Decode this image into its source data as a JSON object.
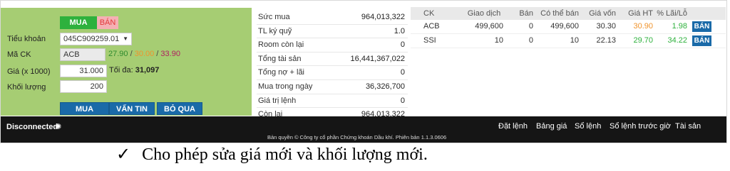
{
  "order_panel": {
    "tab_buy": "MUA",
    "tab_sell": "BÁN",
    "account_label": "Tiểu khoản",
    "account_value": "045C909259.01",
    "symbol_label": "Mã CK",
    "symbol_value": "ACB",
    "price_ref": "27.90",
    "price_sep1": " / ",
    "price_floor": "30.00",
    "price_sep2": " / ",
    "price_ceiling": "33.90",
    "price_label": "Giá (x 1000)",
    "price_value": "31.000",
    "max_label": "Tối đa:",
    "max_value": "31,097",
    "qty_label": "Khối lượng",
    "qty_value": "200",
    "btn_buy": "MUA",
    "btn_query": "VẤN TIN",
    "btn_skip": "BỎ QUA",
    "colors": {
      "ref": "#2e8b2e",
      "floor": "#f0932b",
      "ceiling": "#b02060",
      "panel": "#a6cd73"
    }
  },
  "summary": [
    {
      "label": "Sức mua",
      "value": "964,013,322"
    },
    {
      "label": "TL ký quỹ",
      "value": "1.0"
    },
    {
      "label": "Room còn lại",
      "value": "0"
    },
    {
      "label": "Tổng tài sản",
      "value": "16,441,367,022"
    },
    {
      "label": "Tổng nợ + lãi",
      "value": "0"
    },
    {
      "label": "Mua trong ngày",
      "value": "36,326,700"
    },
    {
      "label": "Giá trị lệnh",
      "value": "0"
    },
    {
      "label": "Còn lại",
      "value": "964,013,322"
    }
  ],
  "portfolio": {
    "headers": {
      "ck": "CK",
      "trade": "Giao dịch",
      "sell": "Bán",
      "can_sell": "Có thể bán",
      "cost": "Giá vốn",
      "price": "Giá HT",
      "pl": "% Lãi/Lỗ"
    },
    "rows": [
      {
        "ck": "ACB",
        "trade": "499,600",
        "sell": "0",
        "can_sell": "499,600",
        "cost": "30.30",
        "price": "30.90",
        "pl": "1.98",
        "action": "BÁN",
        "price_color": "#f0932b"
      },
      {
        "ck": "SSI",
        "trade": "10",
        "sell": "0",
        "can_sell": "10",
        "cost": "22.13",
        "price": "29.70",
        "pl": "34.22",
        "action": "BÁN",
        "price_color": "#2eb13d"
      }
    ],
    "pl_color": "#2eb13d"
  },
  "footer": {
    "status": "Disconnected",
    "nav": [
      "Đặt lệnh",
      "Bảng giá",
      "Sổ lệnh",
      "Sổ lệnh trước giờ",
      "Tài sản"
    ],
    "copyright": "Bản quyền © Công ty cổ phần Chứng khoán Dầu khí. Phiên bản 1.1.3.0606"
  },
  "caption": {
    "check": "✓",
    "text": "Cho phép sửa giá mới và khối lượng mới."
  }
}
